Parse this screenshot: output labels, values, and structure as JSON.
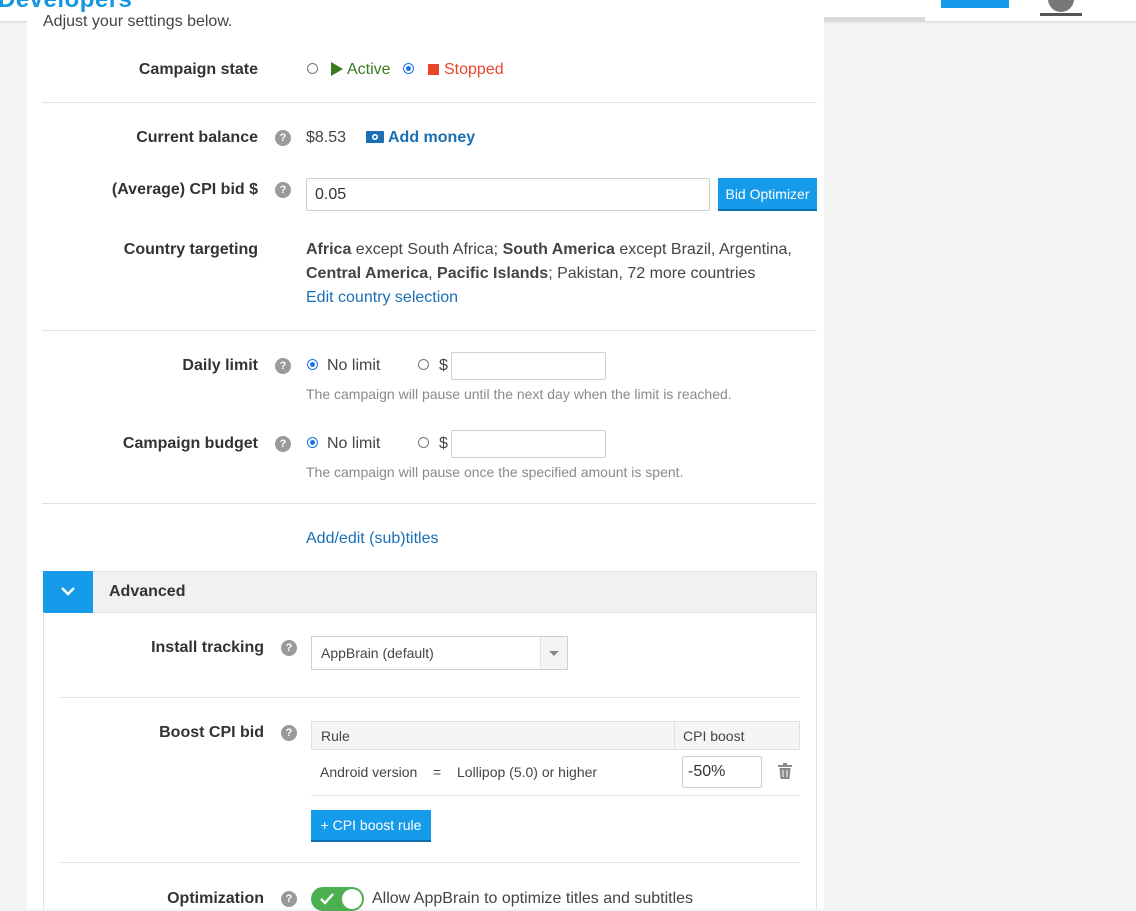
{
  "header": {
    "brand": "Developers"
  },
  "intro": "Adjust your settings below.",
  "campaign_state": {
    "label": "Campaign state",
    "options": [
      {
        "label": "Active",
        "selected": false,
        "color": "#3c7a1e"
      },
      {
        "label": "Stopped",
        "selected": true,
        "color": "#e8462a"
      }
    ]
  },
  "balance": {
    "label": "Current balance",
    "value": "$8.53",
    "add_money": "Add money"
  },
  "cpi_bid": {
    "label": "(Average) CPI bid $",
    "value": "0.05",
    "optimizer_button": "Bid Optimizer"
  },
  "country": {
    "label": "Country targeting",
    "line1": {
      "a": "Africa",
      "b": " except South Africa; ",
      "c": "South America",
      "d": " except Brazil, Argentina,"
    },
    "line2": {
      "a": "Central America",
      "b": ", ",
      "c": "Pacific Islands",
      "d": "; Pakistan, 72 more countries"
    },
    "edit_link": "Edit country selection"
  },
  "daily_limit": {
    "label": "Daily limit",
    "no_limit": "No limit",
    "currency": "$",
    "value": "",
    "hint": "The campaign will pause until the next day when the limit is reached."
  },
  "budget": {
    "label": "Campaign budget",
    "no_limit": "No limit",
    "currency": "$",
    "value": "",
    "hint": "The campaign will pause once the specified amount is spent."
  },
  "subtitles_link": "Add/edit (sub)titles",
  "advanced": {
    "title": "Advanced",
    "install_tracking": {
      "label": "Install tracking",
      "selected": "AppBrain (default)"
    },
    "boost": {
      "label": "Boost CPI bid",
      "col_rule": "Rule",
      "col_boost": "CPI boost",
      "rows": [
        {
          "field": "Android version",
          "op": "=",
          "value": "Lollipop (5.0) or higher",
          "boost": "-50%"
        }
      ],
      "add_button": "+ CPI boost rule"
    },
    "optimization": {
      "label": "Optimization",
      "text": "Allow AppBrain to optimize titles and subtitles",
      "enabled": true
    }
  },
  "colors": {
    "accent": "#169bea",
    "link": "#1a6fb5",
    "toggle_on": "#4caf50"
  }
}
